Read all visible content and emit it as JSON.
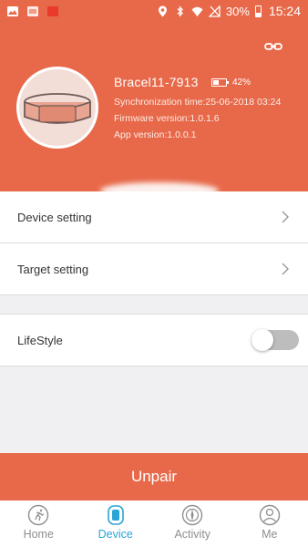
{
  "status_bar": {
    "battery_percent_label": "30%",
    "time": "15:24"
  },
  "header": {
    "device_name": "Bracel11-7913",
    "battery_label": "42%",
    "battery_level": 0.42,
    "sync_time": "Synchronization time:25-06-2018 03:24",
    "firmware_version": "Firmware version:1.0.1.6",
    "app_version": "App version:1.0.0.1"
  },
  "settings": {
    "device_setting": "Device setting",
    "target_setting": "Target setting",
    "lifestyle": "LifeStyle",
    "lifestyle_enabled": false
  },
  "unpair_label": "Unpair",
  "nav": {
    "items": [
      {
        "label": "Home",
        "icon": "home-run-icon",
        "active": false
      },
      {
        "label": "Device",
        "icon": "device-band-icon",
        "active": true
      },
      {
        "label": "Activity",
        "icon": "activity-compass-icon",
        "active": false
      },
      {
        "label": "Me",
        "icon": "person-icon",
        "active": false
      }
    ]
  },
  "colors": {
    "accent": "#e8694a",
    "active_nav": "#2aa5d6"
  }
}
